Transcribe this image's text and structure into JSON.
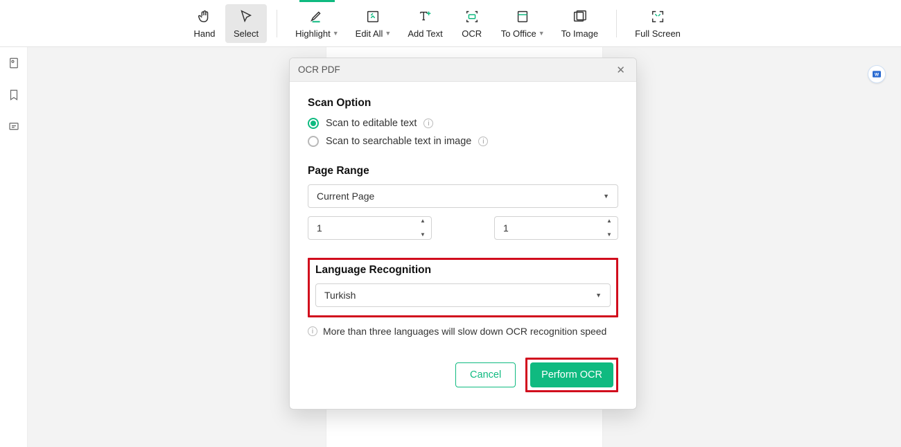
{
  "toolbar": {
    "hand": "Hand",
    "select": "Select",
    "highlight": "Highlight",
    "edit_all": "Edit All",
    "add_text": "Add Text",
    "ocr": "OCR",
    "to_office": "To Office",
    "to_image": "To Image",
    "full_screen": "Full Screen"
  },
  "dialog": {
    "title": "OCR PDF",
    "scan_option_title": "Scan Option",
    "opt_editable": "Scan to editable text",
    "opt_searchable": "Scan to searchable text in image",
    "page_range_title": "Page Range",
    "page_range_value": "Current Page",
    "page_from": "1",
    "page_to": "1",
    "lang_title": "Language Recognition",
    "lang_value": "Turkish",
    "hint": "More than three languages will slow down OCR recognition speed",
    "cancel": "Cancel",
    "perform": "Perform OCR"
  }
}
